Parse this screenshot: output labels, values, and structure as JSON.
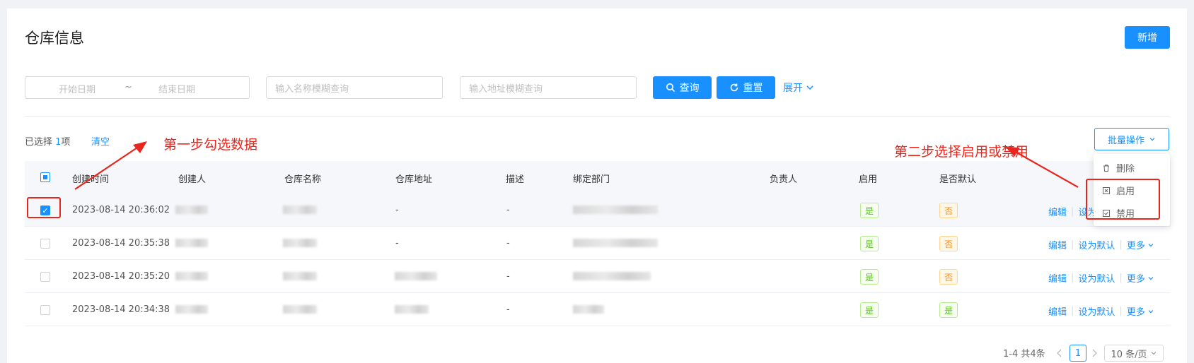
{
  "page": {
    "title": "仓库信息",
    "new_button": "新增"
  },
  "filters": {
    "date_start_placeholder": "开始日期",
    "date_separator": "~",
    "date_end_placeholder": "结束日期",
    "name_placeholder": "输入名称模糊查询",
    "address_placeholder": "输入地址模糊查询",
    "search_label": "查询",
    "reset_label": "重置",
    "expand_label": "展开"
  },
  "selection": {
    "prefix": "已选择 ",
    "count": "1",
    "suffix": "项",
    "clear_label": "清空"
  },
  "annotations": {
    "step1": "第一步勾选数据",
    "step2": "第二步选择启用或禁用"
  },
  "batch": {
    "button_label": "批量操作",
    "menu": [
      {
        "label": "删除",
        "icon": "trash-icon"
      },
      {
        "label": "启用",
        "icon": "enable-icon"
      },
      {
        "label": "禁用",
        "icon": "disable-icon"
      }
    ]
  },
  "table": {
    "columns": [
      "创建时间",
      "创建人",
      "仓库名称",
      "仓库地址",
      "描述",
      "绑定部门",
      "负责人",
      "启用",
      "是否默认"
    ],
    "rows": [
      {
        "created": "2023-08-14 20:36:02",
        "address": "-",
        "desc": "-",
        "enabled": "是",
        "default": "否",
        "checked": true
      },
      {
        "created": "2023-08-14 20:35:38",
        "address": "-",
        "desc": "-",
        "enabled": "是",
        "default": "否",
        "checked": false
      },
      {
        "created": "2023-08-14 20:35:20",
        "address": "",
        "desc": "-",
        "enabled": "是",
        "default": "否",
        "checked": false
      },
      {
        "created": "2023-08-14 20:34:38",
        "address": "",
        "desc": "-",
        "enabled": "是",
        "default": "是",
        "checked": false
      }
    ],
    "ops": {
      "edit": "编辑",
      "set_default": "设为默认",
      "more": "更多"
    }
  },
  "pagination": {
    "summary": "1-4 共4条",
    "current_page": "1",
    "page_size": "10 条/页"
  },
  "colors": {
    "primary": "#1890ff",
    "annotation": "#e8261e",
    "success": "#52c41a",
    "warning": "#fa8c16"
  }
}
